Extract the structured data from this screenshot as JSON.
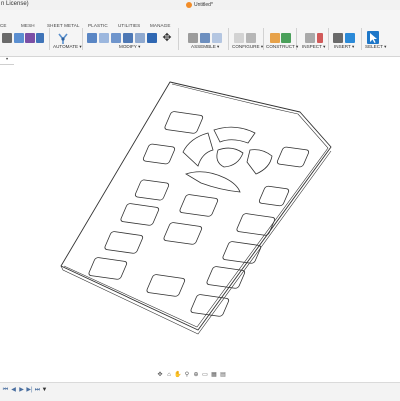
{
  "app": {
    "license_text": "n License)",
    "document_title": "Untitled*"
  },
  "ribbon": {
    "tabs": [
      {
        "id": "solid",
        "label": "CE"
      },
      {
        "id": "mesh",
        "label": "MESH"
      },
      {
        "id": "sheet",
        "label": "SHEET METAL"
      },
      {
        "id": "plastic",
        "label": "PLASTIC"
      },
      {
        "id": "utilities",
        "label": "UTILITIES"
      },
      {
        "id": "manage",
        "label": "MANAGE"
      }
    ],
    "groups": {
      "automate": "AUTOMATE",
      "modify": "MODIFY",
      "assemble": "ASSEMBLE",
      "configure": "CONFIGURE",
      "construct": "CONSTRUCT",
      "inspect": "INSPECT",
      "insert": "INSERT",
      "select": "SELECT"
    },
    "dropdown_glyph": "▾"
  },
  "browser": {
    "toggle_glyph": "•"
  },
  "navbar": {
    "glyphs": [
      "✥",
      "⌂",
      "✋",
      "⚲",
      "⊕",
      "▭",
      "▦",
      "▤"
    ]
  },
  "timeline": {
    "glyphs": [
      "⏮",
      "◀",
      "▶",
      "▶|",
      "⏭",
      "▼"
    ]
  },
  "colors": {
    "accent_orange": "#f28c28",
    "select_blue": "#1e77c8",
    "model_outline": "#333333"
  }
}
